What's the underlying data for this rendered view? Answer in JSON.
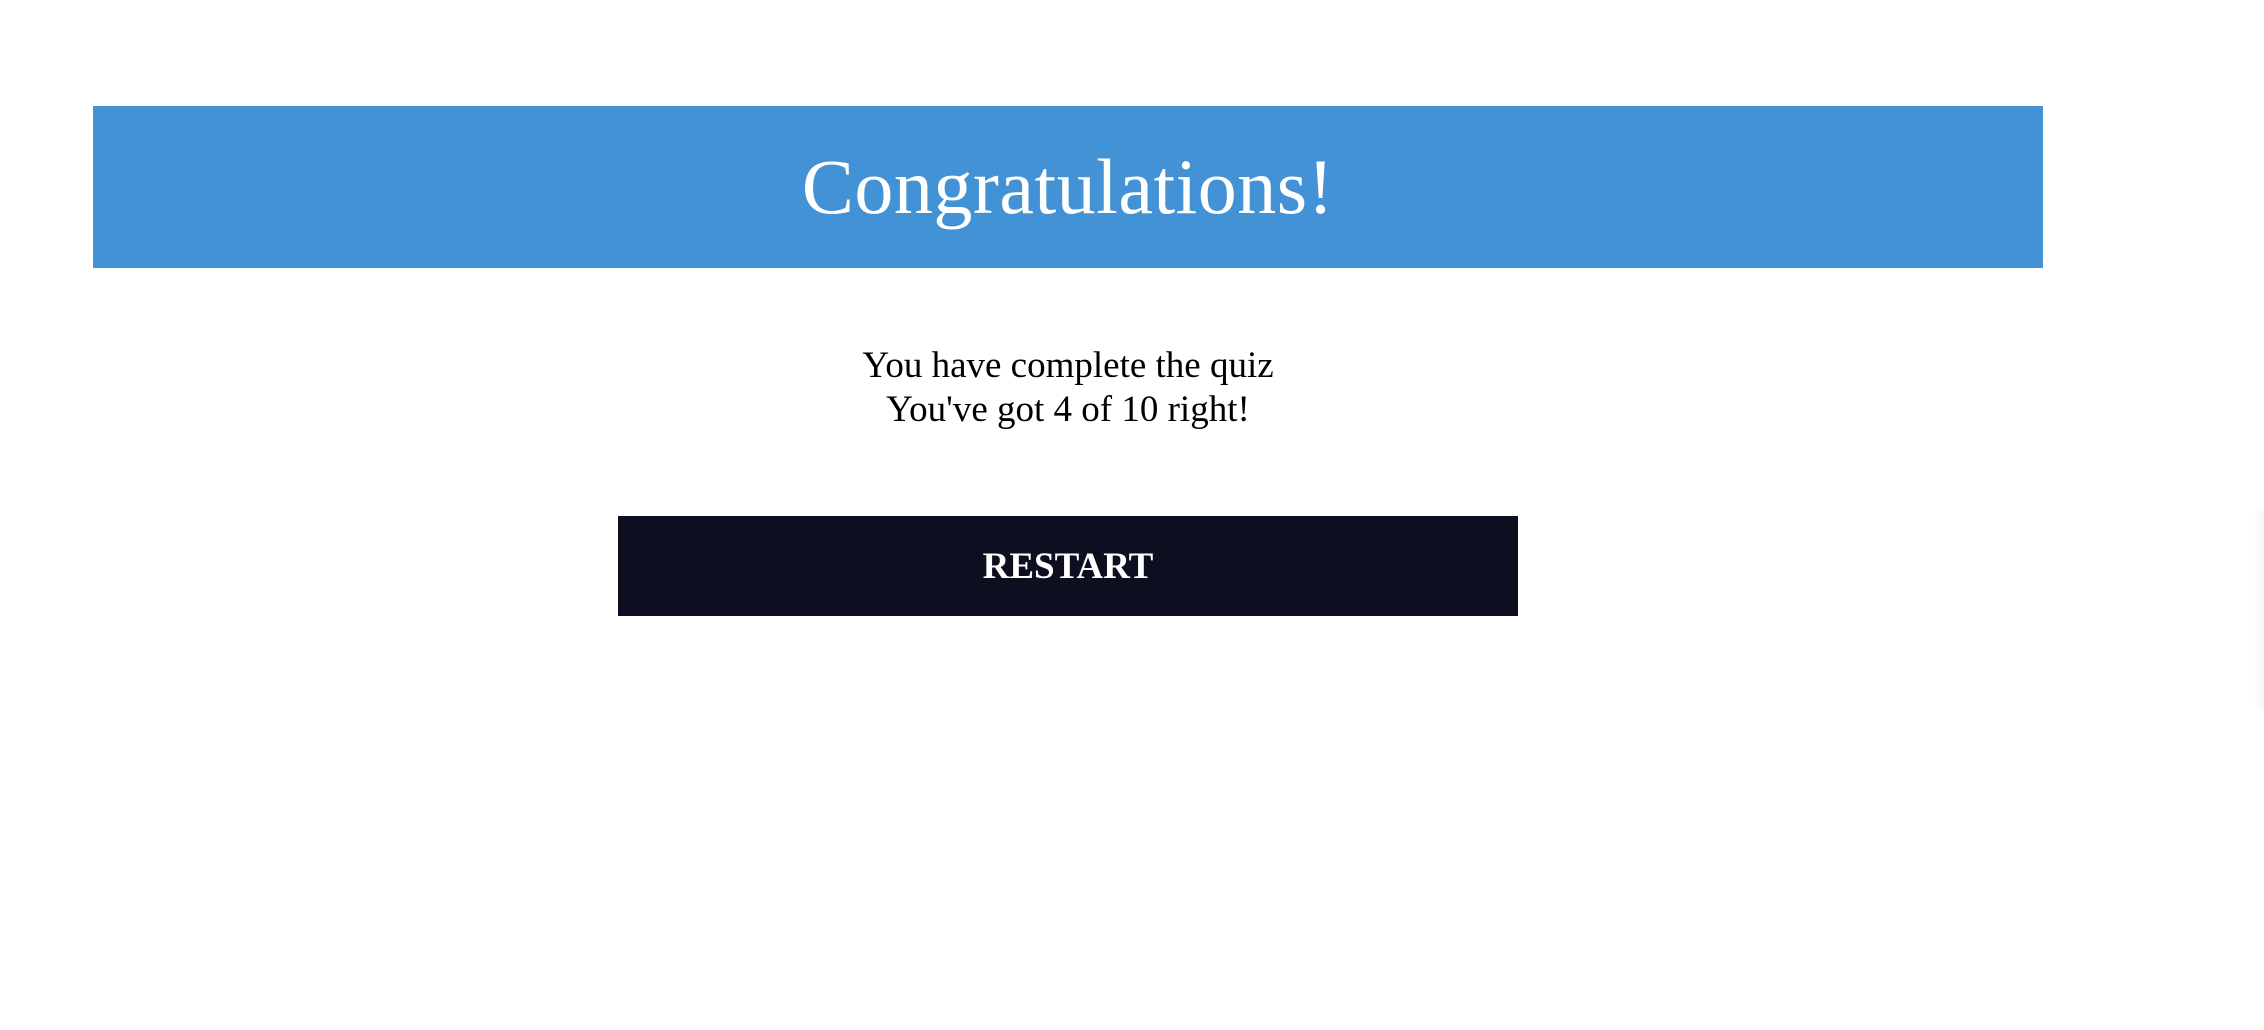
{
  "banner": {
    "title": "Congratulations!",
    "background_color": "#4292d5",
    "text_color": "#ffffff"
  },
  "result": {
    "line1": "You have complete the quiz",
    "line2": "You've got 4 of 10 right!",
    "score_correct": 4,
    "score_total": 10
  },
  "actions": {
    "restart_label": "RESTART",
    "restart_color": "#0d0f20"
  }
}
